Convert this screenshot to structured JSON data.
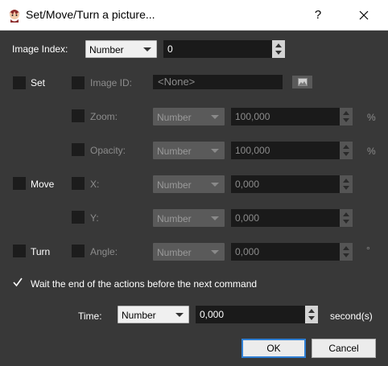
{
  "window": {
    "title": "Set/Move/Turn a picture...",
    "help_label": "?"
  },
  "image_index": {
    "label": "Image Index:",
    "type_value": "Number",
    "value": "0"
  },
  "set": {
    "label": "Set",
    "checked": false,
    "image_id": {
      "label": "Image ID:",
      "value": "<None>"
    },
    "zoom": {
      "label": "Zoom:",
      "type_value": "Number",
      "value": "100,000",
      "unit": "%"
    },
    "opacity": {
      "label": "Opacity:",
      "type_value": "Number",
      "value": "100,000",
      "unit": "%"
    }
  },
  "move": {
    "label": "Move",
    "checked": false,
    "x": {
      "label": "X:",
      "type_value": "Number",
      "value": "0,000"
    },
    "y": {
      "label": "Y:",
      "type_value": "Number",
      "value": "0,000"
    }
  },
  "turn": {
    "label": "Turn",
    "checked": false,
    "angle": {
      "label": "Angle:",
      "type_value": "Number",
      "value": "0,000",
      "unit": "°"
    }
  },
  "wait": {
    "label": "Wait the end of the actions before the next command",
    "checked": true
  },
  "time": {
    "label": "Time:",
    "type_value": "Number",
    "value": "0,000",
    "unit": "second(s)"
  },
  "buttons": {
    "ok": "OK",
    "cancel": "Cancel"
  },
  "colors": {
    "background": "#383838",
    "field": "#1a1a1a",
    "accent": "#2f7fd4"
  }
}
